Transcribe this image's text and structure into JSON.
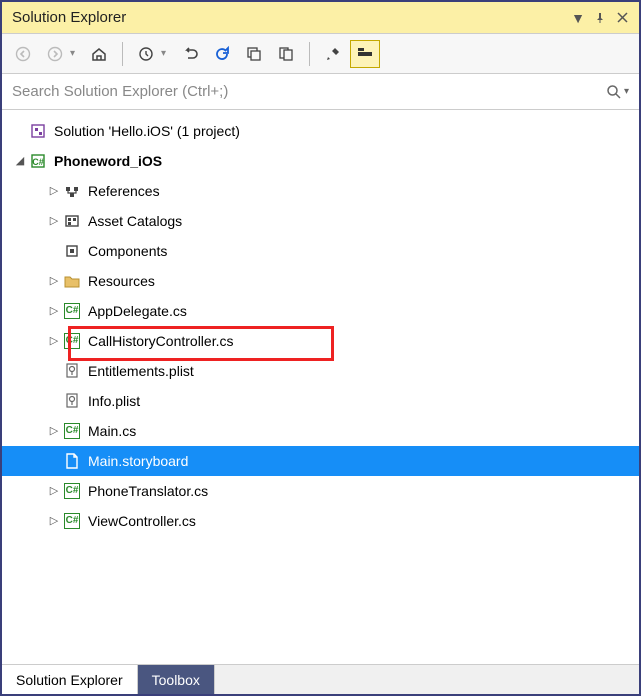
{
  "titlebar": {
    "title": "Solution Explorer"
  },
  "search": {
    "placeholder": "Search Solution Explorer (Ctrl+;)"
  },
  "tree": {
    "solution": "Solution 'Hello.iOS' (1 project)",
    "project": "Phoneword_iOS",
    "items": [
      {
        "label": "References",
        "icon": "refs",
        "expandable": true
      },
      {
        "label": "Asset Catalogs",
        "icon": "ac",
        "expandable": true
      },
      {
        "label": "Components",
        "icon": "comp",
        "expandable": false
      },
      {
        "label": "Resources",
        "icon": "folder",
        "expandable": true
      },
      {
        "label": "AppDelegate.cs",
        "icon": "cs",
        "expandable": true
      },
      {
        "label": "CallHistoryController.cs",
        "icon": "cs",
        "expandable": true,
        "highlight": true
      },
      {
        "label": "Entitlements.plist",
        "icon": "plist",
        "expandable": false
      },
      {
        "label": "Info.plist",
        "icon": "plist",
        "expandable": false
      },
      {
        "label": "Main.cs",
        "icon": "cs",
        "expandable": true
      },
      {
        "label": "Main.storyboard",
        "icon": "file",
        "expandable": false,
        "selected": true
      },
      {
        "label": "PhoneTranslator.cs",
        "icon": "cs",
        "expandable": true
      },
      {
        "label": "ViewController.cs",
        "icon": "cs",
        "expandable": true
      }
    ]
  },
  "tabs": {
    "active": "Solution Explorer",
    "inactive": "Toolbox"
  }
}
